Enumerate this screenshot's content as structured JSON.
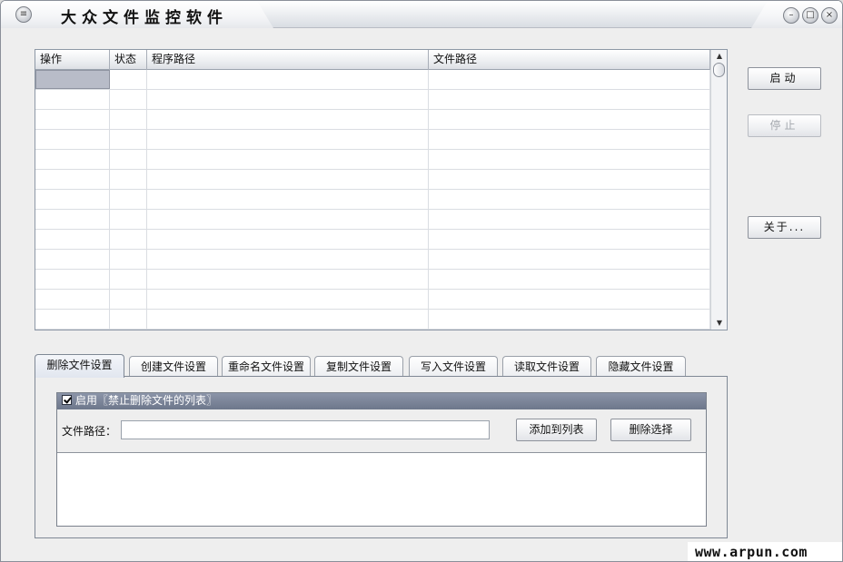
{
  "window": {
    "title": "大众文件监控软件"
  },
  "table": {
    "columns": [
      "操作",
      "状态",
      "程序路径",
      "文件路径"
    ],
    "row_count": 13
  },
  "side_buttons": {
    "start": "启动",
    "stop": "停止",
    "about": "关于..."
  },
  "tabs": [
    {
      "label": "删除文件设置",
      "active": true
    },
    {
      "label": "创建文件设置",
      "active": false
    },
    {
      "label": "重命名文件设置",
      "active": false
    },
    {
      "label": "复制文件设置",
      "active": false
    },
    {
      "label": "写入文件设置",
      "active": false
    },
    {
      "label": "读取文件设置",
      "active": false
    },
    {
      "label": "隐藏文件设置",
      "active": false
    }
  ],
  "panel": {
    "enable_checkbox_label": "启用〖禁止删除文件的列表〗",
    "enable_checked": true,
    "path_label": "文件路径：",
    "path_value": "",
    "add_button": "添加到列表",
    "delete_button": "删除选择"
  },
  "watermark": "www.arpun.com",
  "icons": {
    "app_menu": "menu-icon",
    "minimize": "minimize-icon",
    "maximize": "maximize-icon",
    "close": "close-icon"
  }
}
